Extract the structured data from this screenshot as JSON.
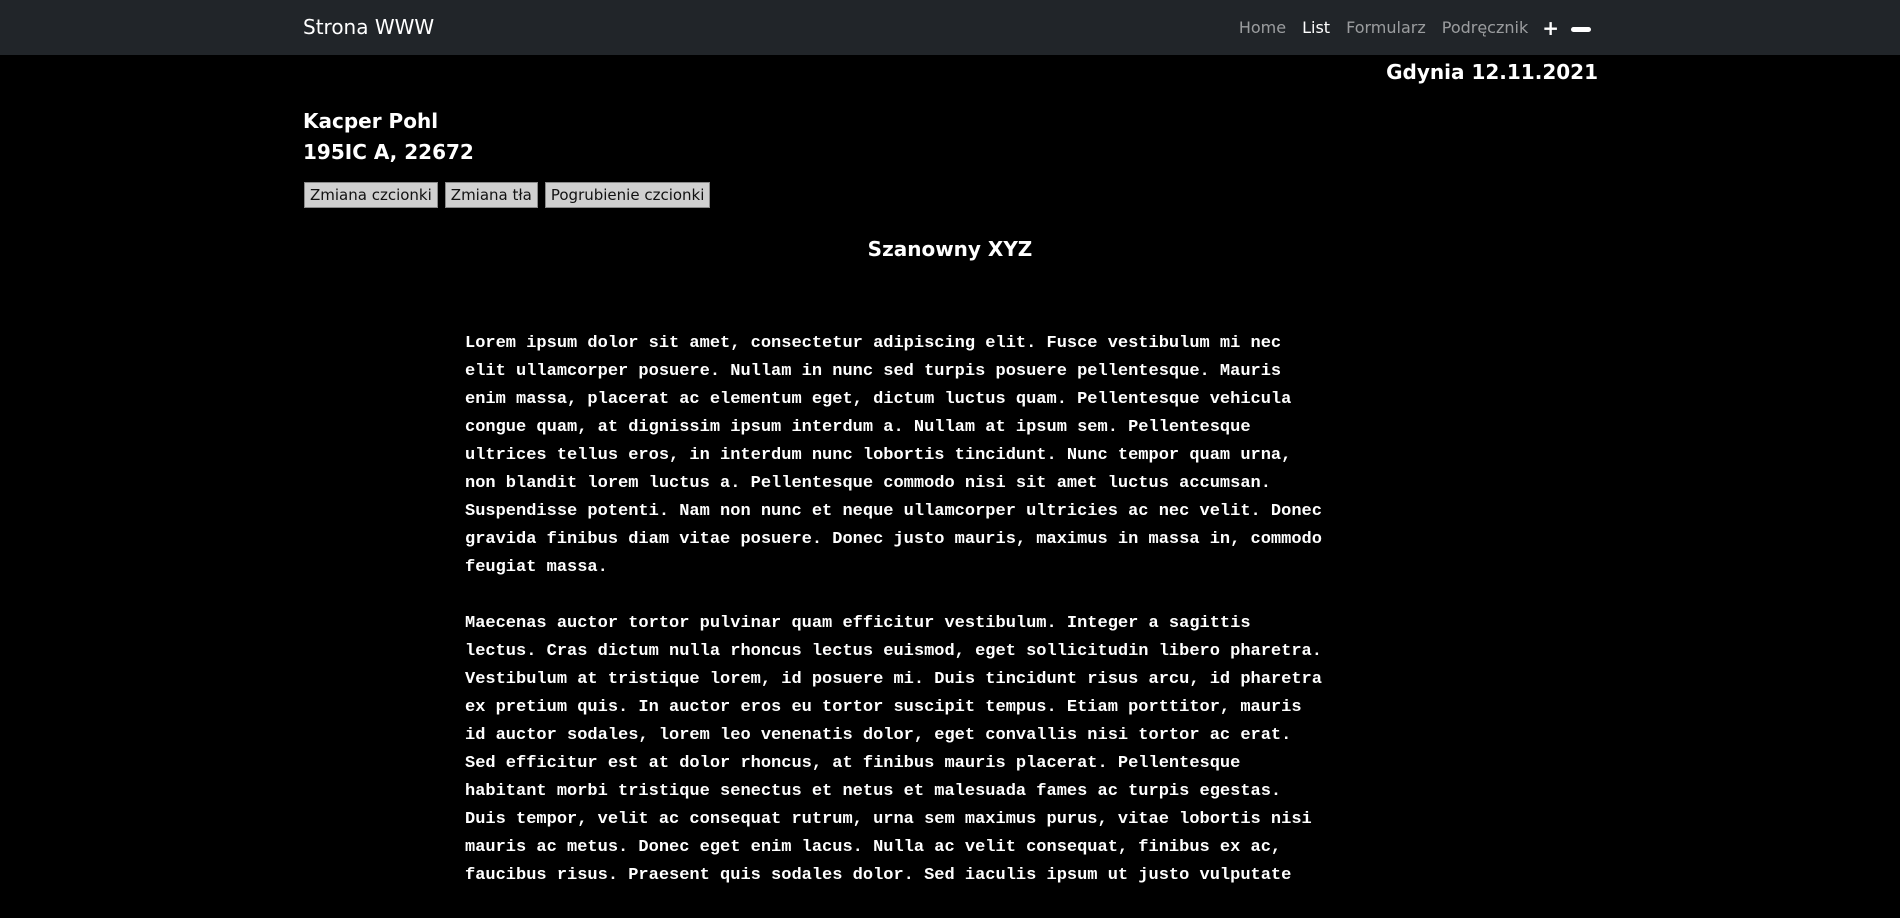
{
  "navbar": {
    "brand": "Strona WWW",
    "links": [
      {
        "label": "Home",
        "active": false
      },
      {
        "label": "List",
        "active": true
      },
      {
        "label": "Formularz",
        "active": false
      },
      {
        "label": "Podręcznik",
        "active": false
      }
    ],
    "plus_label": "+"
  },
  "letter": {
    "date": "Gdynia 12.11.2021",
    "sender_name": "Kacper Pohl",
    "sender_address": "195IC A, 22672",
    "greeting": "Szanowny XYZ",
    "paragraphs": [
      "Lorem ipsum dolor sit amet, consectetur adipiscing elit. Fusce vestibulum mi nec\nelit ullamcorper posuere. Nullam in nunc sed turpis posuere pellentesque. Mauris\nenim massa, placerat ac elementum eget, dictum luctus quam. Pellentesque vehicula\ncongue quam, at dignissim ipsum interdum a. Nullam at ipsum sem. Pellentesque\nultrices tellus eros, in interdum nunc lobortis tincidunt. Nunc tempor quam urna,\nnon blandit lorem luctus a. Pellentesque commodo nisi sit amet luctus accumsan.\nSuspendisse potenti. Nam non nunc et neque ullamcorper ultricies ac nec velit. Donec\ngravida finibus diam vitae posuere. Donec justo mauris, maximus in massa in, commodo\nfeugiat massa.",
      "Maecenas auctor tortor pulvinar quam efficitur vestibulum. Integer a sagittis\nlectus. Cras dictum nulla rhoncus lectus euismod, eget sollicitudin libero pharetra.\nVestibulum at tristique lorem, id posuere mi. Duis tincidunt risus arcu, id pharetra\nex pretium quis. In auctor eros eu tortor suscipit tempus. Etiam porttitor, mauris\nid auctor sodales, lorem leo venenatis dolor, eget convallis nisi tortor ac erat.\nSed efficitur est at dolor rhoncus, at finibus mauris placerat. Pellentesque\nhabitant morbi tristique senectus et netus et malesuada fames ac turpis egestas.\nDuis tempor, velit ac consequat rutrum, urna sem maximus purus, vitae lobortis nisi\nmauris ac metus. Donec eget enim lacus. Nulla ac velit consequat, finibus ex ac,\nfaucibus risus. Praesent quis sodales dolor. Sed iaculis ipsum ut justo vulputate"
    ]
  },
  "controls": {
    "font_change": "Zmiana czcionki",
    "bg_change": "Zmiana tła",
    "bold_change": "Pogrubienie czcionki"
  },
  "icons": {
    "plus": "plus-icon",
    "minus": "minus-icon"
  },
  "colors": {
    "navbar_bg": "#212529",
    "page_bg": "#000000",
    "text": "#ffffff",
    "nav_inactive": "#8c8c8c",
    "button_bg": "#d0d0d0"
  }
}
